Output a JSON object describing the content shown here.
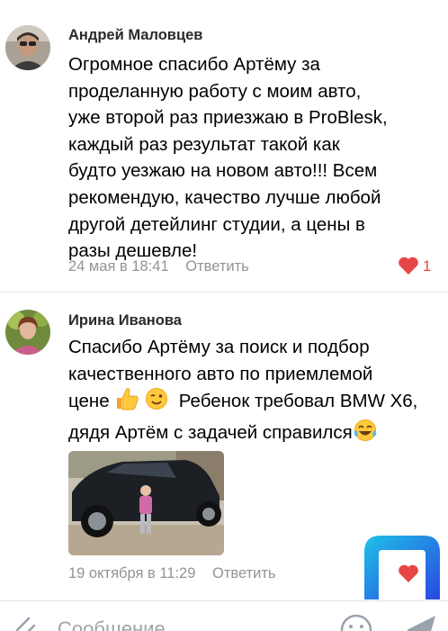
{
  "comments": [
    {
      "author": "Андрей Маловцев",
      "lines": [
        "Огромное спасибо Артёму за",
        "проделанную работу с моим авто,",
        "уже второй раз приезжаю в ProBlesk,",
        "каждый раз результат такой как",
        "будто уезжаю на новом авто!!! Всем",
        "рекомендую, качество лучше любой",
        "другой детейлинг студии, а цены в",
        "разы дешевле!"
      ],
      "date": "24 мая в 18:41",
      "reply": "Ответить",
      "likes": "1",
      "avatar_icon": "avatar-man"
    },
    {
      "author": "Ирина Иванова",
      "lines": [
        "Спасибо Артёму за поиск и подбор",
        "качественного авто по приемлемой",
        "цене",
        "Ребенок требовал BMW X6,",
        "дядя Артём с задачей справился"
      ],
      "emojis": [
        "thumbs-up",
        "winking-face",
        "tears-of-joy"
      ],
      "photo_icon": "car-photo",
      "date": "19 октября в 11:29",
      "reply": "Ответить",
      "avatar_icon": "avatar-woman"
    }
  ],
  "composer": {
    "placeholder": "Сообщение"
  },
  "colors": {
    "like": "#e64646",
    "meta": "#939393",
    "logo_gradient_start": "#1fc1e8",
    "logo_gradient_end": "#2a47e0"
  }
}
